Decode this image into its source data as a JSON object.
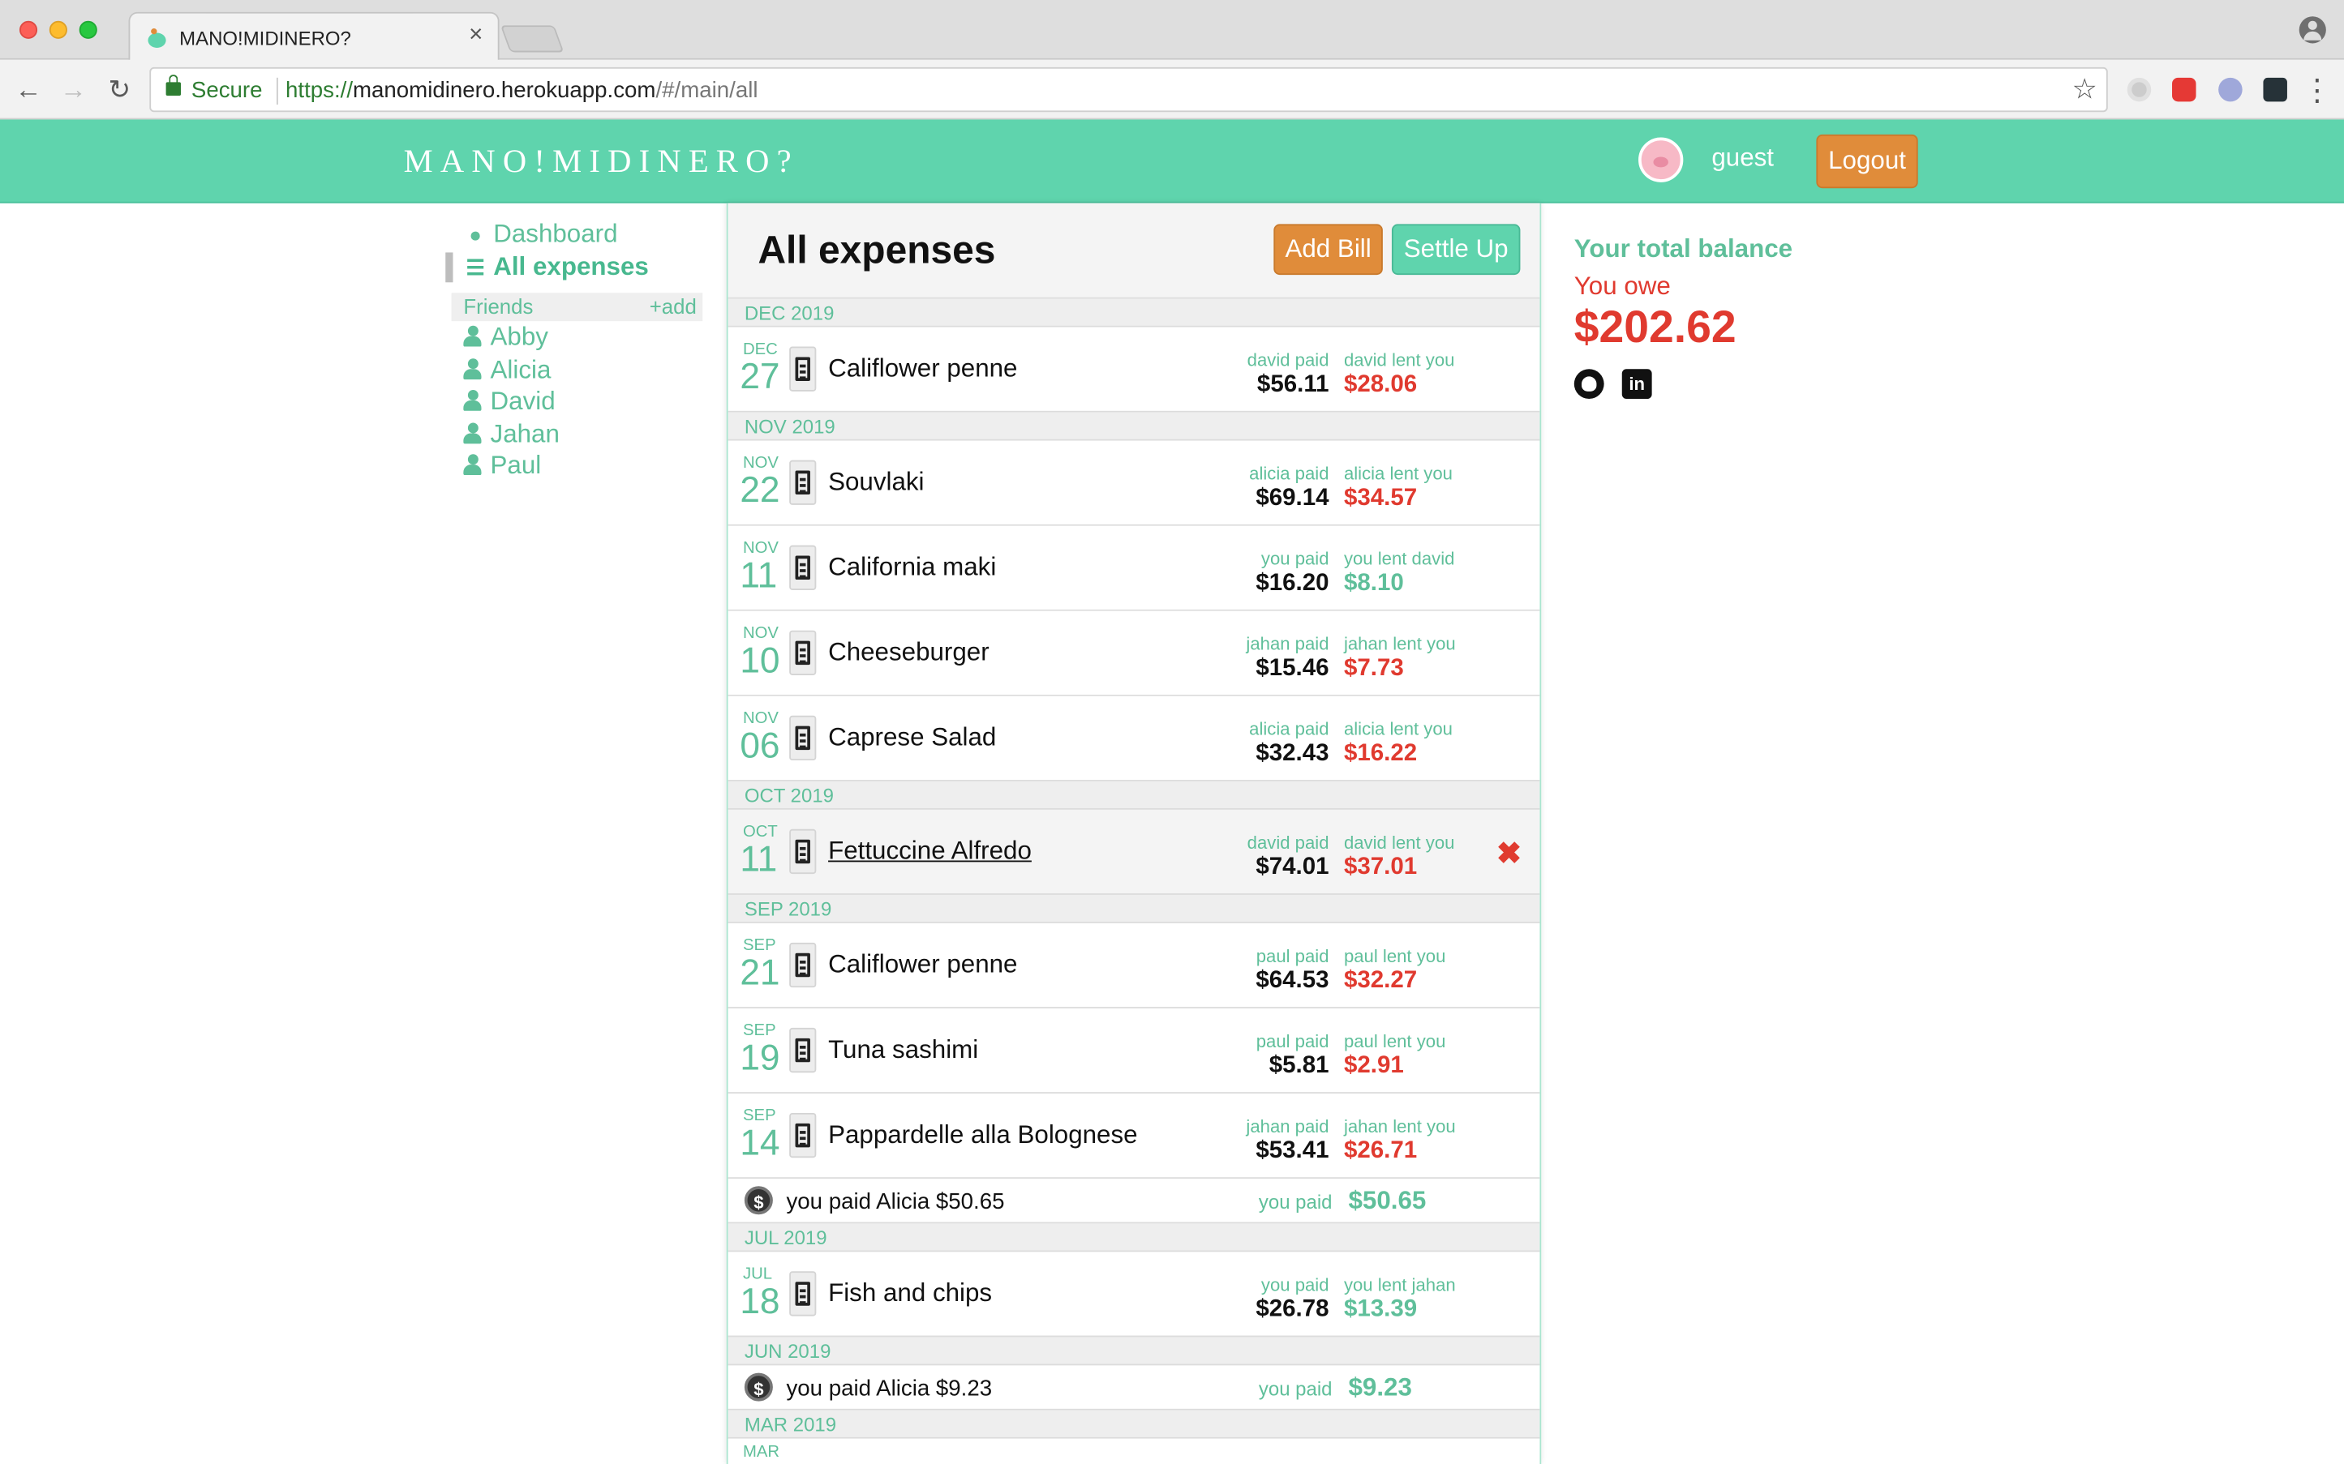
{
  "browser": {
    "tab_title": "MANO!MIDINERO?",
    "tab_close": "×",
    "secure_label": "Secure",
    "url_scheme": "https://",
    "url_host": "manomidinero.herokuapp.com",
    "url_path": "/#/main/all",
    "back": "←",
    "forward": "→",
    "reload": "↻",
    "star": "☆",
    "menu": "⋮"
  },
  "header": {
    "brand": "MANO!MIDINERO?",
    "username": "guest",
    "logout_label": "Logout",
    "background": "#5fd4ad"
  },
  "sidebar": {
    "dashboard_label": "Dashboard",
    "all_expenses_label": "All expenses",
    "friends_label": "Friends",
    "add_label": "+add",
    "friends": [
      "Abby",
      "Alicia",
      "David",
      "Jahan",
      "Paul"
    ]
  },
  "main": {
    "title": "All expenses",
    "add_bill_label": "Add Bill",
    "settle_up_label": "Settle Up",
    "months": [
      {
        "label": "DEC 2019",
        "items": [
          {
            "type": "bill",
            "mon": "DEC",
            "day": "27",
            "desc": "Califlower penne",
            "paid_label": "david paid",
            "paid": "$56.11",
            "lent_label": "david lent you",
            "lent": "$28.06",
            "owed": true
          }
        ]
      },
      {
        "label": "NOV 2019",
        "items": [
          {
            "type": "bill",
            "mon": "NOV",
            "day": "22",
            "desc": "Souvlaki",
            "paid_label": "alicia paid",
            "paid": "$69.14",
            "lent_label": "alicia lent you",
            "lent": "$34.57",
            "owed": true
          },
          {
            "type": "bill",
            "mon": "NOV",
            "day": "11",
            "desc": "California maki",
            "paid_label": "you paid",
            "paid": "$16.20",
            "lent_label": "you lent david",
            "lent": "$8.10",
            "owed": false
          },
          {
            "type": "bill",
            "mon": "NOV",
            "day": "10",
            "desc": "Cheeseburger",
            "paid_label": "jahan paid",
            "paid": "$15.46",
            "lent_label": "jahan lent you",
            "lent": "$7.73",
            "owed": true
          },
          {
            "type": "bill",
            "mon": "NOV",
            "day": "06",
            "desc": "Caprese Salad",
            "paid_label": "alicia paid",
            "paid": "$32.43",
            "lent_label": "alicia lent you",
            "lent": "$16.22",
            "owed": true
          }
        ]
      },
      {
        "label": "OCT 2019",
        "items": [
          {
            "type": "bill",
            "mon": "OCT",
            "day": "11",
            "desc": "Fettuccine Alfredo",
            "paid_label": "david paid",
            "paid": "$74.01",
            "lent_label": "david lent you",
            "lent": "$37.01",
            "owed": true,
            "selected": true,
            "delete": "✖"
          }
        ]
      },
      {
        "label": "SEP 2019",
        "items": [
          {
            "type": "bill",
            "mon": "SEP",
            "day": "21",
            "desc": "Califlower penne",
            "paid_label": "paul paid",
            "paid": "$64.53",
            "lent_label": "paul lent you",
            "lent": "$32.27",
            "owed": true
          },
          {
            "type": "bill",
            "mon": "SEP",
            "day": "19",
            "desc": "Tuna sashimi",
            "paid_label": "paul paid",
            "paid": "$5.81",
            "lent_label": "paul lent you",
            "lent": "$2.91",
            "owed": true
          },
          {
            "type": "bill",
            "mon": "SEP",
            "day": "14",
            "desc": "Pappardelle alla Bolognese",
            "paid_label": "jahan paid",
            "paid": "$53.41",
            "lent_label": "jahan lent you",
            "lent": "$26.71",
            "owed": true
          },
          {
            "type": "payment",
            "desc": "you paid Alicia $50.65",
            "label": "you paid",
            "amount": "$50.65"
          }
        ]
      },
      {
        "label": "JUL 2019",
        "items": [
          {
            "type": "bill",
            "mon": "JUL",
            "day": "18",
            "desc": "Fish and chips",
            "paid_label": "you paid",
            "paid": "$26.78",
            "lent_label": "you lent jahan",
            "lent": "$13.39",
            "owed": false
          }
        ]
      },
      {
        "label": "JUN 2019",
        "items": [
          {
            "type": "payment",
            "desc": "you paid Alicia $9.23",
            "label": "you paid",
            "amount": "$9.23"
          }
        ]
      },
      {
        "label": "MAR 2019",
        "items": [
          {
            "type": "cut",
            "mon": "MAR"
          }
        ]
      }
    ]
  },
  "balance": {
    "title": "Your total balance",
    "status": "You owe",
    "amount": "$202.62",
    "linkedin_glyph": "in",
    "owe_color": "#e03a2f",
    "accent_color": "#5fbf9a"
  }
}
